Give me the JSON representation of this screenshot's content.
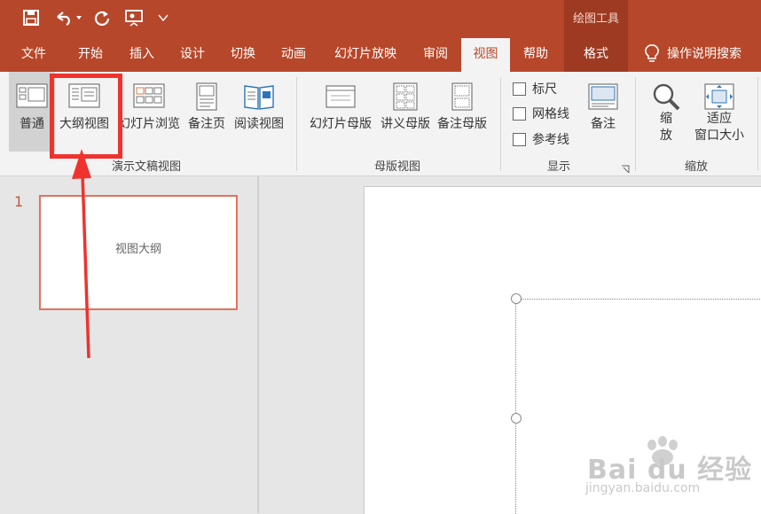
{
  "titlebar": {
    "context_group": "绘图工具",
    "quick_access": [
      "save-icon",
      "undo-icon",
      "redo-icon",
      "present-icon",
      "customize-icon"
    ]
  },
  "tabs": [
    "文件",
    "开始",
    "插入",
    "设计",
    "切换",
    "动画",
    "幻灯片放映",
    "审阅",
    "视图",
    "帮助",
    "格式"
  ],
  "active_tab": "视图",
  "tell_me": "操作说明搜索",
  "ribbon": {
    "presentation_views": {
      "group_label": "演示文稿视图",
      "normal": "普通",
      "outline": "大纲视图",
      "slide_sorter": "幻灯片浏览",
      "notes_page": "备注页",
      "reading_view": "阅读视图"
    },
    "master_views": {
      "group_label": "母版视图",
      "slide_master": "幻灯片母版",
      "handout_master": "讲义母版",
      "notes_master": "备注母版"
    },
    "show": {
      "group_label": "显示",
      "ruler": "标尺",
      "gridlines": "网格线",
      "guides": "参考线",
      "notes": "备注"
    },
    "zoom": {
      "group_label": "缩放",
      "zoom_line1": "缩",
      "zoom_line2": "放",
      "fit_line1": "适应",
      "fit_line2": "窗口大小"
    }
  },
  "slides": [
    {
      "number": "1",
      "text": "视图大纲"
    }
  ],
  "watermark": {
    "text": "Bai du 经验",
    "sub": "jingyan.baidu.com"
  },
  "colors": {
    "accent": "#b7472a",
    "highlight": "#f0322e"
  }
}
